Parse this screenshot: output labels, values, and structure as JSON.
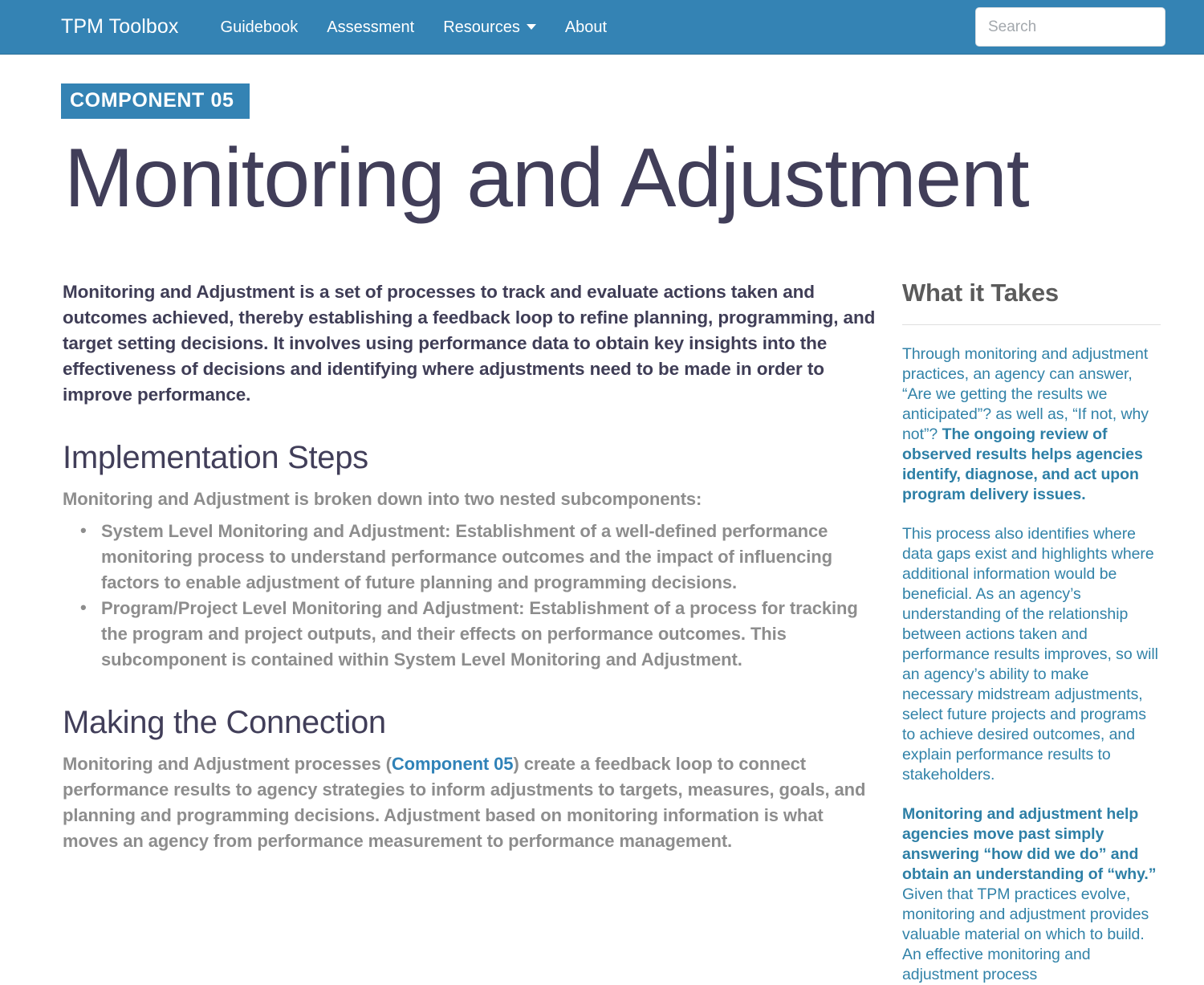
{
  "navbar": {
    "brand": "TPM Toolbox",
    "links": [
      {
        "label": "Guidebook",
        "has_caret": false
      },
      {
        "label": "Assessment",
        "has_caret": false
      },
      {
        "label": "Resources",
        "has_caret": true
      },
      {
        "label": "About",
        "has_caret": false
      }
    ],
    "search": {
      "placeholder": "Search",
      "value": ""
    },
    "background_color": "#3483b4"
  },
  "header": {
    "badge": "COMPONENT 05",
    "badge_color": "#3483b4",
    "title": "Monitoring and Adjustment",
    "title_color": "#413e59"
  },
  "main": {
    "lead": "Monitoring and Adjustment is a set of processes to track and evaluate actions taken and outcomes achieved, thereby establishing a feedback loop to refine planning, programming, and target setting decisions. It involves using performance data to obtain key insights into the effectiveness of decisions and identifying where adjustments need to be made in order to improve performance.",
    "sections": [
      {
        "heading": "Implementation Steps",
        "intro": "Monitoring and Adjustment is broken down into two nested subcomponents:",
        "bullets": [
          "System Level Monitoring and Adjustment: Establishment of a well-defined performance monitoring process to understand performance outcomes and the impact of influencing factors to enable adjustment of future planning and programming decisions.",
          "Program/Project Level Monitoring and Adjustment: Establishment of a process for tracking the program and project outputs, and their effects on performance outcomes. This subcomponent is contained within System Level Monitoring and Adjustment."
        ]
      }
    ],
    "connection": {
      "heading": "Making the Connection",
      "text_before_link": "Monitoring and Adjustment processes (",
      "link_text": "Component 05",
      "link_color": "#2f82b8",
      "text_after_link": ") create a feedback loop to connect performance results to agency strategies to inform adjustments to targets, measures, goals, and planning and programming decisions. Adjustment based on monitoring information is what moves an agency from performance measurement to performance management."
    }
  },
  "sidebar": {
    "heading": "What it Takes",
    "heading_color": "#5b5b5b",
    "text_color": "#3182a8",
    "paragraphs": [
      {
        "segments": [
          {
            "text": "Through monitoring and adjustment practices, an agency can answer, “Are we getting the results we anticipated”? as well as, “If not, why not”? ",
            "bold": false
          },
          {
            "text": "The ongoing review of observed results helps agencies identify, diagnose, and act upon program delivery issues.",
            "bold": true
          }
        ]
      },
      {
        "segments": [
          {
            "text": "This process also identifies where data gaps exist and highlights where additional information would be beneficial. As an agency’s understanding of the relationship between actions taken and performance results improves, so will an agency’s ability to make necessary midstream adjustments, select future projects and programs to achieve desired outcomes, and explain performance results to stakeholders.",
            "bold": false
          }
        ]
      },
      {
        "segments": [
          {
            "text": "Monitoring and adjustment help agencies move past simply answering “how did we do” and obtain an understanding of “why.” ",
            "bold": true
          },
          {
            "text": "Given that TPM practices evolve, monitoring and adjustment provides valuable material on which to build. An effective monitoring and adjustment process",
            "bold": false
          }
        ]
      }
    ]
  }
}
